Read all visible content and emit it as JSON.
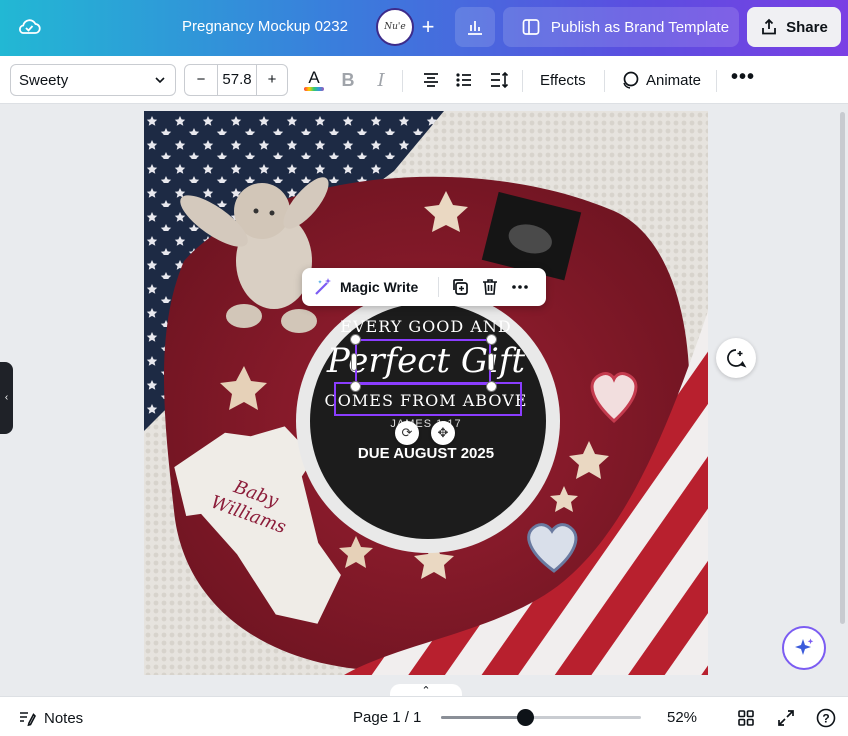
{
  "topbar": {
    "doc_title": "Pregnancy Mockup 0232",
    "brand_initials": "Nu'e",
    "add_label": "+",
    "publish_label": "Publish as Brand Template",
    "share_label": "Share"
  },
  "toolbar": {
    "font_name": "Sweety",
    "font_size": "57.8",
    "minus": "−",
    "plus": "+",
    "color_glyph": "A",
    "bold_glyph": "B",
    "italic_glyph": "I",
    "effects_label": "Effects",
    "animate_label": "Animate",
    "more_glyph": "•••"
  },
  "design": {
    "line1": "EVERY GOOD AND",
    "line2": "Perfect Gift",
    "line3": "COMES FROM ABOVE",
    "line4": "JAMES 1:17",
    "line5": "DUE AUGUST 2025",
    "onesie": "Baby Williams"
  },
  "context_menu": {
    "magic_write": "Magic Write"
  },
  "bottombar": {
    "notes_label": "Notes",
    "page_label": "Page 1 / 1",
    "zoom_value": "52%",
    "zoom_fraction": 0.42,
    "help_glyph": "?"
  },
  "colors": {
    "accent": "#8b3dff",
    "sign_black": "#1c1c1c",
    "blanket_red": "#8e1c2c"
  }
}
